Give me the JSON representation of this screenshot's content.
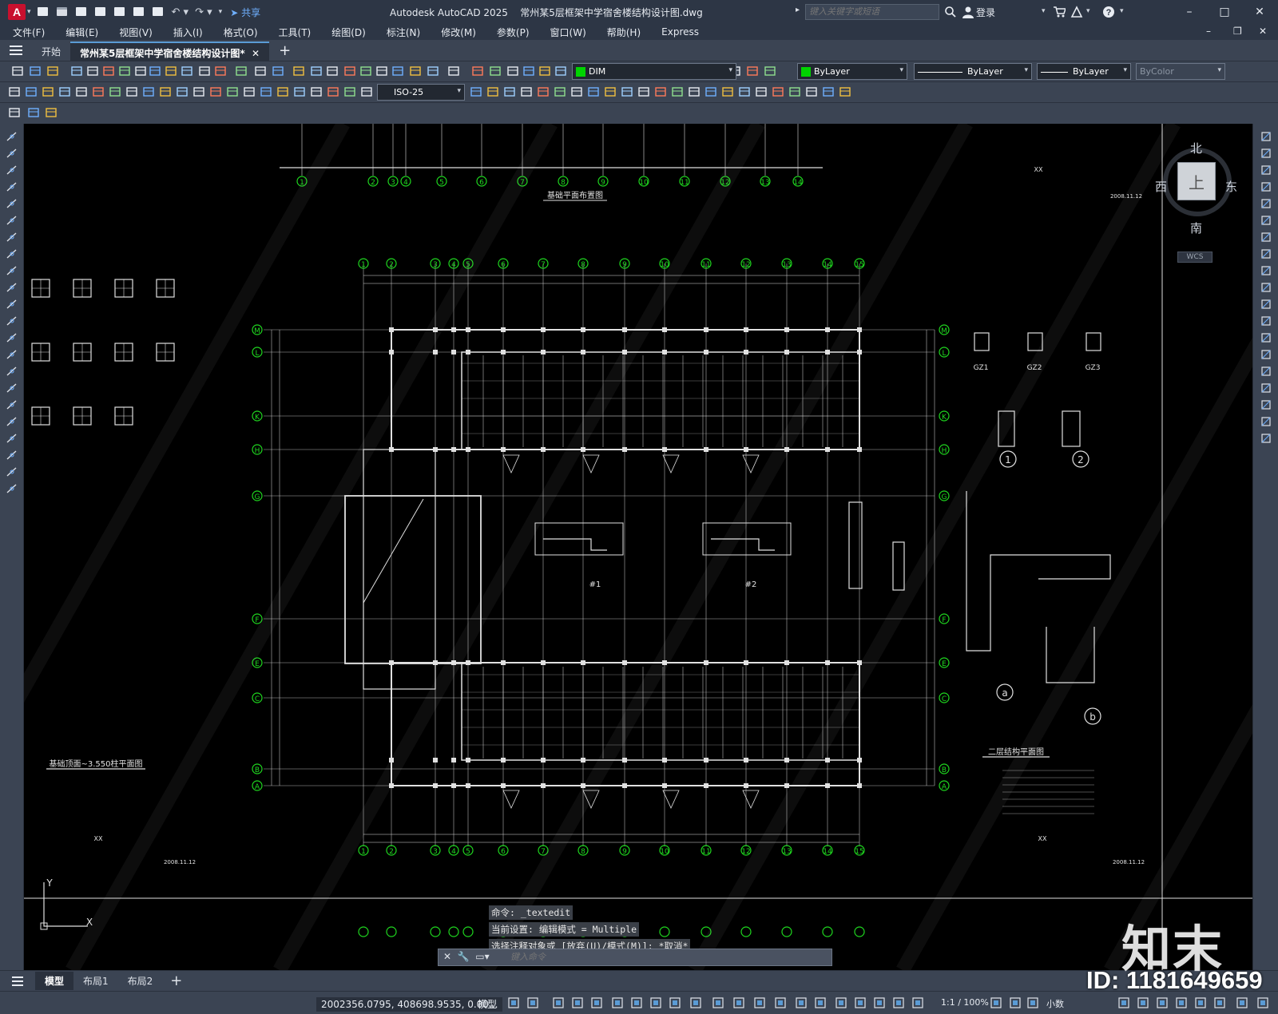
{
  "app": {
    "logo_letter": "A",
    "title": "Autodesk AutoCAD 2025",
    "document": "常州某5层框架中学宿舍楼结构设计图.dwg",
    "share_label": "共享",
    "search_placeholder": "键入关键字或短语",
    "login_label": "登录",
    "window_buttons": [
      "–",
      "□",
      "✕"
    ]
  },
  "menubar": {
    "items": [
      "文件(F)",
      "编辑(E)",
      "视图(V)",
      "插入(I)",
      "格式(O)",
      "工具(T)",
      "绘图(D)",
      "标注(N)",
      "修改(M)",
      "参数(P)",
      "窗口(W)",
      "帮助(H)",
      "Express"
    ]
  },
  "tabs": {
    "start": "开始",
    "document_tab": "常州某5层框架中学宿舍楼结构设计图*",
    "close_glyph": "✕",
    "new_glyph": "+"
  },
  "toolbars": {
    "layer_name": "DIM",
    "color_combo": "ByLayer",
    "linetype_combo": "ByLayer",
    "lineweight_combo": "ByLayer",
    "plotstyle_combo": "ByColor",
    "dimstyle_combo": "ISO-25"
  },
  "viewcube": {
    "north": "北",
    "south": "南",
    "west": "西",
    "east": "东",
    "top_face": "上",
    "wcs": "WCS"
  },
  "drawing": {
    "plan_title_main": "二层结构平面图",
    "plan_title_left": "基础顶面~3.550柱平面图",
    "plan_title_top": "基础平面布置图",
    "axis_numbers": [
      "1",
      "2",
      "3",
      "4",
      "5",
      "6",
      "7",
      "8",
      "9",
      "10",
      "11",
      "12",
      "13",
      "14",
      "15"
    ],
    "axis_letters": [
      "M",
      "L",
      "K",
      "H",
      "G",
      "F",
      "E",
      "C",
      "B",
      "A"
    ],
    "section_labels": [
      "#1",
      "#2"
    ],
    "col_labels": [
      "GZ1",
      "GZ2",
      "GZ3"
    ],
    "marker_1": "1",
    "marker_2": "2",
    "marker_a": "a",
    "marker_b": "b",
    "date_text": "2008.11.12",
    "xx": "XX"
  },
  "command": {
    "history": [
      "命令: _textedit",
      "当前设置: 编辑模式 = Multiple",
      "选择注释对象或 [放弃(U)/模式(M)]: *取消*"
    ],
    "input_placeholder": "键入命令"
  },
  "layout_tabs": {
    "items": [
      "模型",
      "布局1",
      "布局2"
    ],
    "active": "模型"
  },
  "status": {
    "coords": "2002356.0795, 408698.9535, 0.00...",
    "model": "模型",
    "scale": "1:1 / 100%",
    "units": "小数"
  },
  "watermark": {
    "logo": "知末",
    "id": "ID: 1181649659"
  },
  "colors": {
    "axis_green": "#1fd81f",
    "line_white": "#e0e0e0",
    "layer_green": "#00d400",
    "accent_blue": "#5a9bd5"
  }
}
